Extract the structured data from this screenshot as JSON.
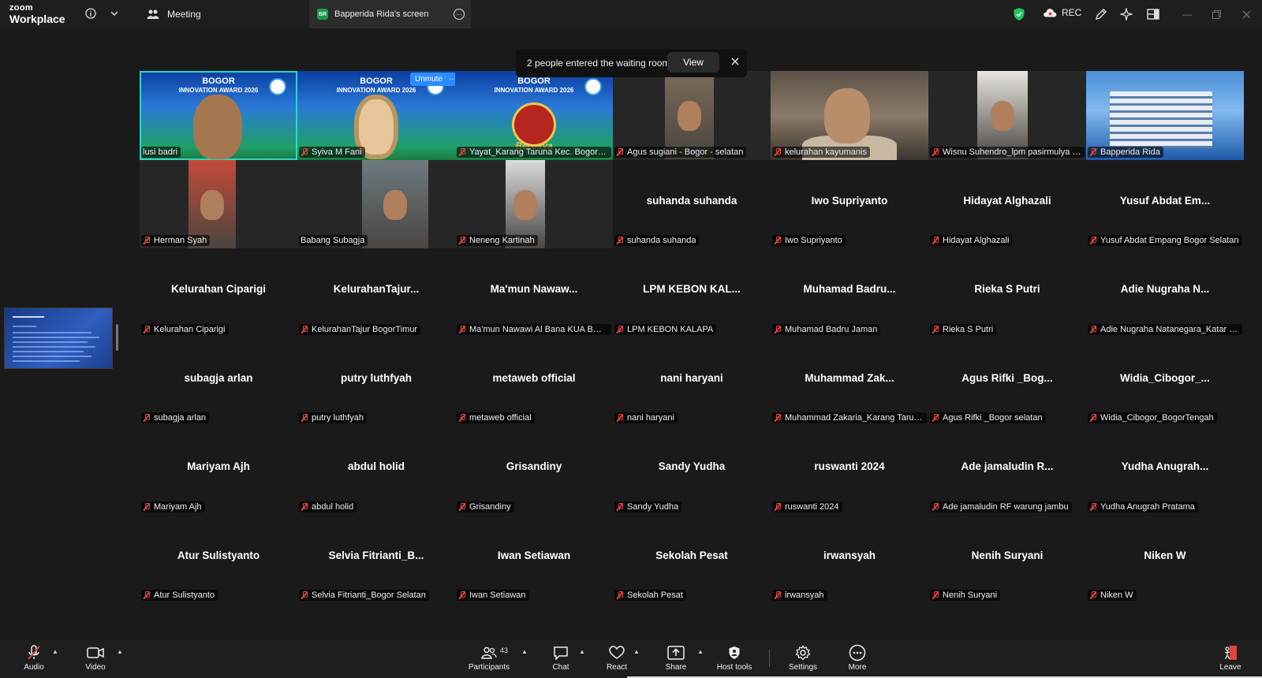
{
  "app": {
    "logo_top": "zoom",
    "logo_bottom": "Workplace",
    "meeting_tab": "Meeting",
    "screen_tab": "Bapperida Rida's screen",
    "screen_tab_initials": "BR",
    "rec_label": "REC"
  },
  "notification": {
    "text": "2 people entered the waiting room",
    "view_label": "View"
  },
  "unmute_popup": {
    "label": "Unmute",
    "more": "···"
  },
  "tiles": [
    {
      "display": "",
      "label": "lusi badri",
      "kind": "award",
      "active": true,
      "muted": false
    },
    {
      "display": "",
      "label": "Syiva M Fani",
      "kind": "award-avatar",
      "muted": true
    },
    {
      "display": "",
      "label": "Yayat_Karang Taruna Kec. Bogor S...",
      "kind": "award-logo",
      "muted": true
    },
    {
      "display": "",
      "label": "Agus sugiani - Bogor - selatan",
      "kind": "photo",
      "muted": true
    },
    {
      "display": "",
      "label": "kelurahan kayumanis",
      "kind": "kel",
      "muted": true
    },
    {
      "display": "",
      "label": "Wisnu Suhendro_lpm pasirmulya B...",
      "kind": "photo2",
      "muted": true
    },
    {
      "display": "",
      "label": "Bapperida Rida",
      "kind": "bappeda",
      "muted": true
    },
    {
      "display": "",
      "label": "Herman Syah",
      "kind": "photo3",
      "muted": true
    },
    {
      "display": "",
      "label": "Babang Subagja",
      "kind": "photo4",
      "muted": false
    },
    {
      "display": "",
      "label": "Neneng Kartinah",
      "kind": "photo5",
      "muted": true
    },
    {
      "display": "suhanda suhanda",
      "label": "suhanda suhanda",
      "muted": true
    },
    {
      "display": "Iwo Supriyanto",
      "label": "Iwo Supriyanto",
      "muted": true
    },
    {
      "display": "Hidayat Alghazali",
      "label": "Hidayat Alghazali",
      "muted": true
    },
    {
      "display": "Yusuf Abdat Em...",
      "label": "Yusuf Abdat Empang Bogor Selatan",
      "muted": true
    },
    {
      "display": "Kelurahan Ciparigi",
      "label": "Kelurahan Ciparigi",
      "muted": true
    },
    {
      "display": "KelurahanTajur...",
      "label": "KelurahanTajur BogorTimur",
      "muted": true
    },
    {
      "display": "Ma'mun Nawaw...",
      "label": "Ma'mun Nawawi Al Bana KUA BOG...",
      "muted": true
    },
    {
      "display": "LPM KEBON KAL...",
      "label": "LPM KEBON KALAPA",
      "muted": true
    },
    {
      "display": "Muhamad Badru...",
      "label": "Muhamad Badru Jaman",
      "muted": true
    },
    {
      "display": "Rieka S Putri",
      "label": "Rieka S Putri",
      "muted": true
    },
    {
      "display": "Adie Nugraha N...",
      "label": "Adie Nugraha Natanegara_Katar T...",
      "muted": true
    },
    {
      "display": "subagja arlan",
      "label": "subagja arlan",
      "muted": true
    },
    {
      "display": "putry luthfyah",
      "label": "putry luthfyah",
      "muted": true
    },
    {
      "display": "metaweb official",
      "label": "metaweb official",
      "muted": true
    },
    {
      "display": "nani haryani",
      "label": "nani haryani",
      "muted": true
    },
    {
      "display": "Muhammad Zak...",
      "label": "Muhammad Zakaria_Karang Taruna...",
      "muted": true
    },
    {
      "display": "Agus Rifki _Bog...",
      "label": "Agus Rifki _Bogor selatan",
      "muted": true
    },
    {
      "display": "Widia_Cibogor_...",
      "label": "Widia_Cibogor_BogorTengah",
      "muted": true
    },
    {
      "display": "Mariyam Ajh",
      "label": "Mariyam Ajh",
      "muted": true
    },
    {
      "display": "abdul holid",
      "label": "abdul holid",
      "muted": true
    },
    {
      "display": "Grisandiny",
      "label": "Grisandiny",
      "muted": true
    },
    {
      "display": "Sandy Yudha",
      "label": "Sandy Yudha",
      "muted": true
    },
    {
      "display": "ruswanti 2024",
      "label": "ruswanti 2024",
      "muted": true
    },
    {
      "display": "Ade jamaludin R...",
      "label": "Ade jamaludin RF warung jambu",
      "muted": true
    },
    {
      "display": "Yudha Anugrah...",
      "label": "Yudha Anugrah Pratama",
      "muted": true
    },
    {
      "display": "Atur Sulistyanto",
      "label": "Atur Sulistyanto",
      "muted": true
    },
    {
      "display": "Selvia Fitrianti_B...",
      "label": "Selvia Fitrianti_Bogor Selatan",
      "muted": true
    },
    {
      "display": "Iwan Setiawan",
      "label": "Iwan Setiawan",
      "muted": true
    },
    {
      "display": "Sekolah Pesat",
      "label": "Sekolah Pesat",
      "muted": true
    },
    {
      "display": "irwansyah",
      "label": "irwansyah",
      "muted": true
    },
    {
      "display": "Nenih Suryani",
      "label": "Nenih Suryani",
      "muted": true
    },
    {
      "display": "Niken W",
      "label": "Niken W",
      "muted": true
    }
  ],
  "award_banner": {
    "line1": "BOGOR",
    "line2": "INNOVATION AWARD 2026",
    "logo_text": "Berdaya"
  },
  "toolbar": {
    "audio": "Audio",
    "video": "Video",
    "participants": "Participants",
    "participants_count": "43",
    "chat": "Chat",
    "react": "React",
    "share": "Share",
    "host_tools": "Host tools",
    "settings": "Settings",
    "more": "More",
    "leave": "Leave"
  },
  "colors": {
    "accent": "#2d8cff",
    "active_border": "#2fd5c9",
    "muted": "#e0443e",
    "leave": "#e0443e"
  }
}
